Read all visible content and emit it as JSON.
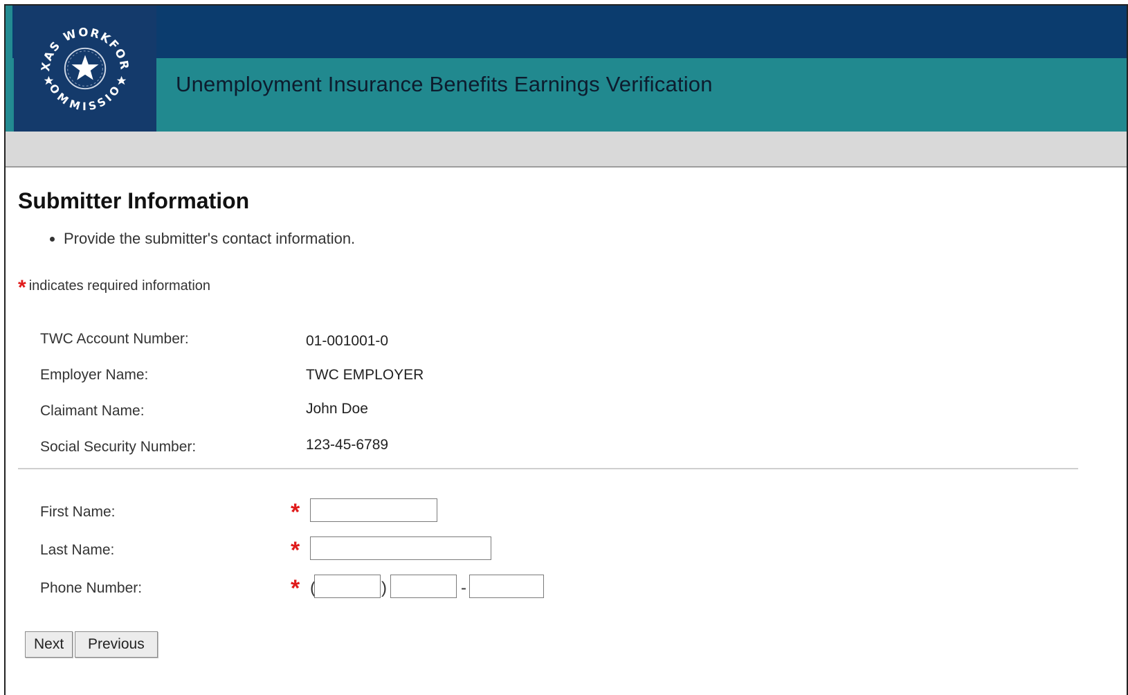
{
  "header": {
    "logo_text_top": "TEXAS WORKFORCE",
    "logo_text_bottom": "COMMISSION",
    "app_title": "Unemployment Insurance Benefits Earnings Verification"
  },
  "page": {
    "title": "Submitter Information",
    "instructions": [
      "Provide the submitter's contact information."
    ],
    "required_note": "indicates required information"
  },
  "info": [
    {
      "label": "TWC Account Number:",
      "value": "01-001001-0"
    },
    {
      "label": "Employer Name:",
      "value": "TWC EMPLOYER"
    },
    {
      "label": "Claimant Name:",
      "value": "John Doe"
    },
    {
      "label": "Social Security Number:",
      "value": "123-45-6789"
    }
  ],
  "form": {
    "first_name": {
      "label": "First Name:",
      "value": "",
      "required": true
    },
    "last_name": {
      "label": "Last Name:",
      "value": "",
      "required": true
    },
    "phone": {
      "label": "Phone Number:",
      "area": "",
      "prefix": "",
      "line": "",
      "required": true,
      "open_paren": "(",
      "close_paren": ")",
      "dash": "-"
    },
    "required_mark": "*"
  },
  "buttons": {
    "next": "Next",
    "previous": "Previous"
  },
  "colors": {
    "header_top": "#0b3c6e",
    "header_main": "#21898f",
    "logo_bg": "#143a6b",
    "required": "#e01b1b"
  }
}
